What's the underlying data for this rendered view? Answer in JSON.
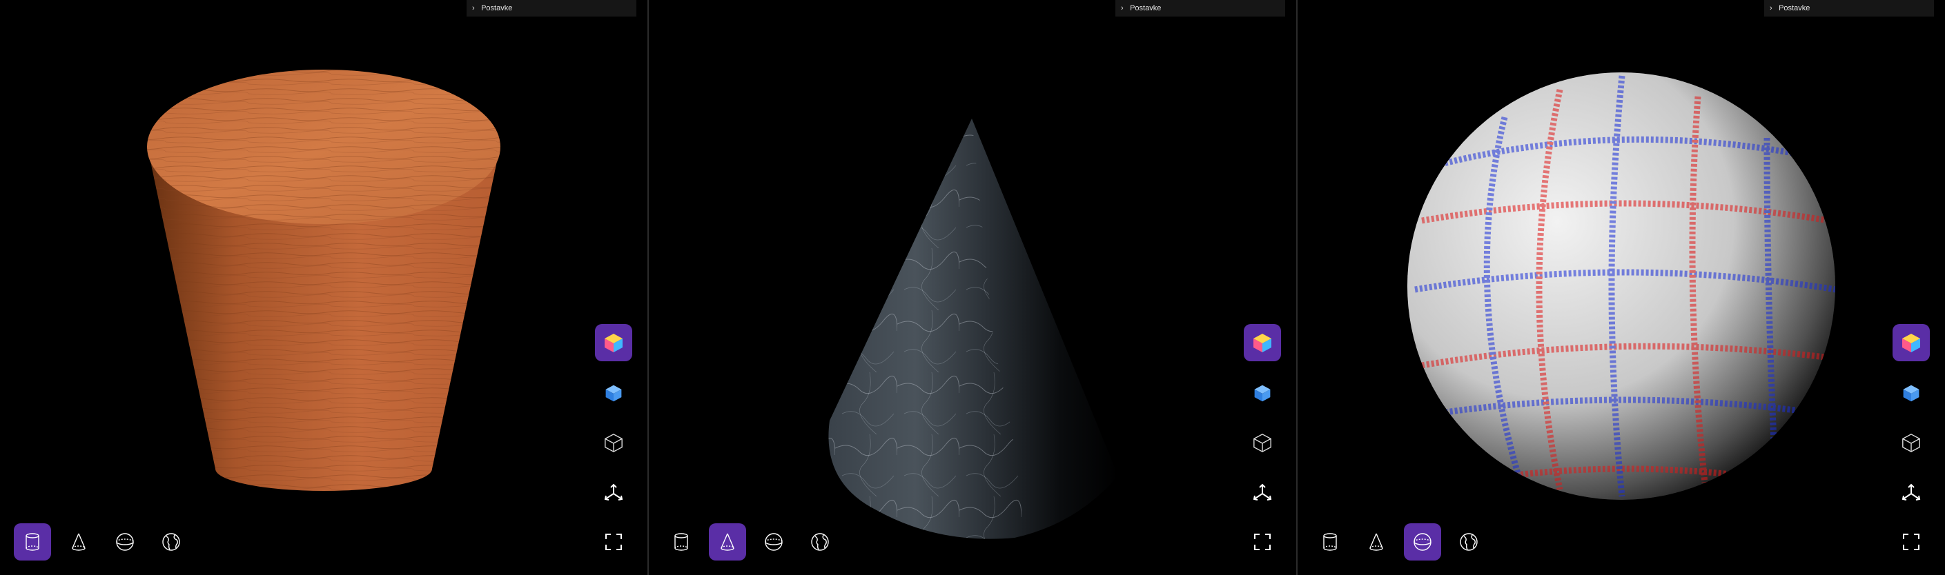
{
  "settings_label": "Postavke",
  "panels": [
    {
      "id": "cylinder",
      "shape": "cylinder-icon",
      "texture": "wood",
      "active_shape": 0
    },
    {
      "id": "cone",
      "shape": "cone-icon",
      "texture": "marble",
      "active_shape": 1
    },
    {
      "id": "sphere",
      "shape": "sphere-icon",
      "texture": "fabric-plaid",
      "active_shape": 2
    }
  ],
  "shape_buttons": [
    "cylinder-icon",
    "cone-icon",
    "sphere-icon",
    "globe-icon"
  ],
  "side_buttons": [
    "color-cube-icon",
    "blue-cube-icon",
    "wireframe-cube-icon",
    "axes-icon"
  ],
  "fullscreen_icon": "fullscreen-icon",
  "colors": {
    "accent": "#5a2ea6",
    "background": "#000000",
    "bar": "#161616"
  }
}
